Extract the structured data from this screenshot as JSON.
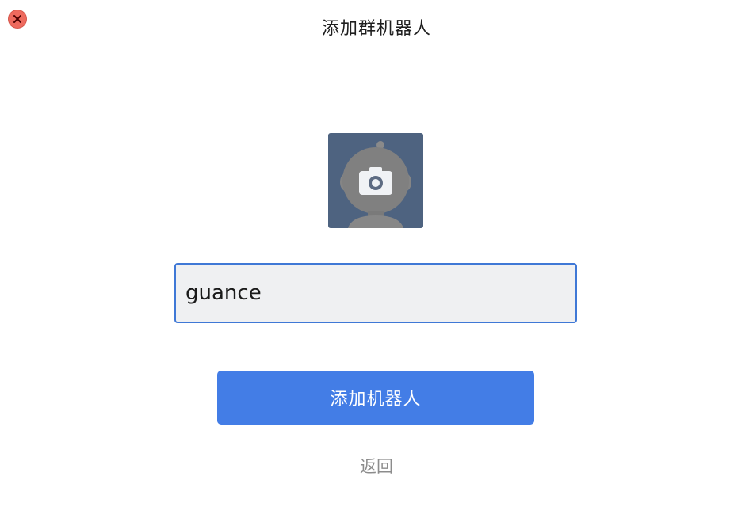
{
  "window": {
    "title": "添加群机器人"
  },
  "avatar": {
    "icon": "robot-avatar-with-camera-icon",
    "overlay_color": "#4e6380"
  },
  "name_input": {
    "value": "guance"
  },
  "actions": {
    "add_label": "添加机器人",
    "back_label": "返回"
  },
  "colors": {
    "accent": "#437de6",
    "close": "#ee6a5e",
    "input_bg": "#eff0f2"
  }
}
